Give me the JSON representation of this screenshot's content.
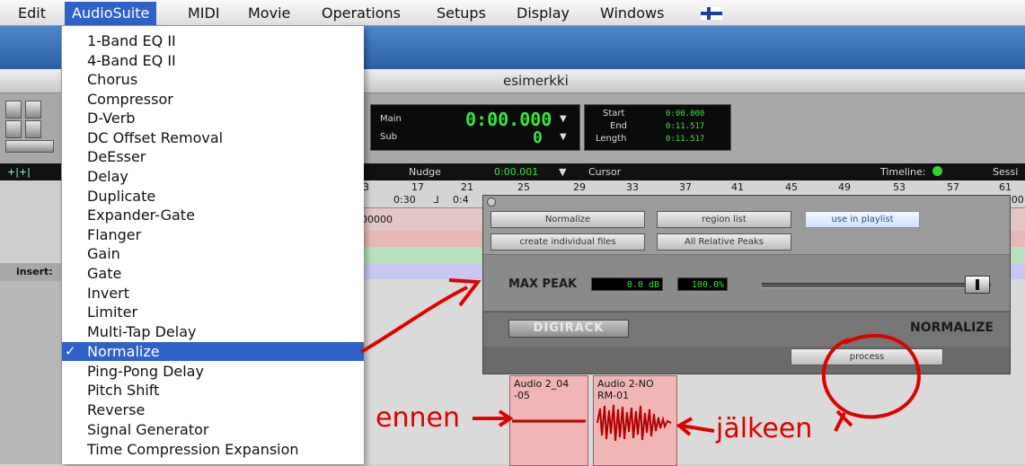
{
  "menubar": {
    "items": [
      "Edit",
      "AudioSuite",
      "MIDI",
      "Movie",
      "Operations",
      "Setups",
      "Display",
      "Windows"
    ],
    "active": "AudioSuite",
    "flag_icon": "finnish-flag-icon"
  },
  "window": {
    "title": "esimerkki"
  },
  "counter": {
    "main_label": "Main",
    "main_value": "0:00.000",
    "sub_label": "Sub",
    "sub_value": "0"
  },
  "selection": {
    "start_label": "Start",
    "start_value": "0:00.000",
    "end_label": "End",
    "end_value": "0:11.517",
    "length_label": "Length",
    "length_value": "0:11.517"
  },
  "edit_bar": {
    "nudge_label": "Nudge",
    "nudge_value": "0:00.001",
    "cursor_label": "Cursor",
    "timeline_label": "Timeline:",
    "session_label": "Sessi"
  },
  "ruler": {
    "bars": [
      "3",
      "17",
      "21",
      "25",
      "29",
      "33",
      "37",
      "41",
      "45",
      "49",
      "53",
      "57",
      "61"
    ],
    "row2": [
      "0:30",
      "0:4"
    ],
    "row2_right": ":00"
  },
  "track": {
    "value": "00000",
    "insert_label": "insert:"
  },
  "audiosuite_menu": {
    "items": [
      "1-Band EQ II",
      "4-Band EQ II",
      "Chorus",
      "Compressor",
      "D-Verb",
      "DC Offset Removal",
      "DeEsser",
      "Delay",
      "Duplicate",
      "Expander-Gate",
      "Flanger",
      "Gain",
      "Gate",
      "Invert",
      "Limiter",
      "Multi-Tap Delay",
      "Normalize",
      "Ping-Pong Delay",
      "Pitch Shift",
      "Reverse",
      "Signal Generator",
      "Time Compression Expansion"
    ],
    "selected": "Normalize",
    "check_icon": "checkmark-icon"
  },
  "dialog": {
    "plugin_button": "Normalize",
    "region_list_button": "region list",
    "use_in_playlist_button": "use in playlist",
    "create_files_button": "create individual files",
    "peaks_button": "All Relative Peaks",
    "max_peak_label": "MAX PEAK",
    "db_value": "0.0 dB",
    "percent_value": "100.0%",
    "slider_level_percent": 100,
    "brand": "DIGIRACK",
    "plugin_name": "NORMALIZE",
    "process_button": "process"
  },
  "clips": {
    "before_name": "Audio 2_04 -05",
    "after_name": "Audio 2-NO RM-01"
  },
  "annotations": {
    "before": "ennen",
    "after": "jälkeen",
    "color": "#e00000"
  }
}
